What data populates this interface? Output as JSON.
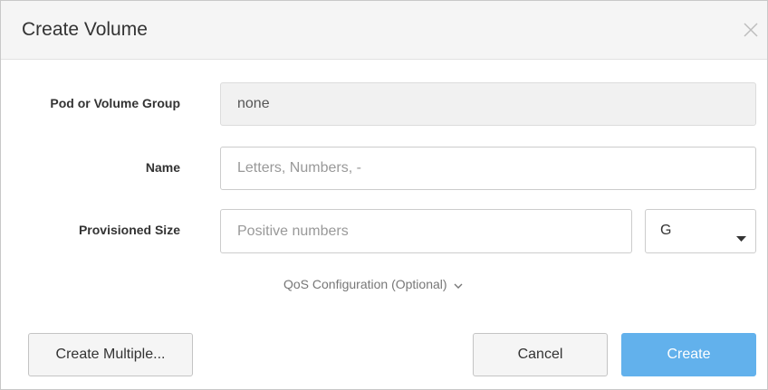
{
  "dialog": {
    "title": "Create Volume",
    "close_icon": "close-icon"
  },
  "form": {
    "pod_group": {
      "label": "Pod or Volume Group",
      "value": "none"
    },
    "name": {
      "label": "Name",
      "value": "",
      "placeholder": "Letters, Numbers, -"
    },
    "size": {
      "label": "Provisioned Size",
      "value": "",
      "placeholder": "Positive numbers",
      "unit": "G",
      "caret_icon": "caret-down-icon"
    },
    "qos": {
      "label": "QoS Configuration (Optional)",
      "chevron_icon": "chevron-down-icon"
    }
  },
  "footer": {
    "create_multiple_label": "Create Multiple...",
    "cancel_label": "Cancel",
    "create_label": "Create"
  },
  "colors": {
    "primary_button": "#62b1ec",
    "header_background": "#f5f5f5",
    "readonly_field": "#f1f1f1"
  }
}
